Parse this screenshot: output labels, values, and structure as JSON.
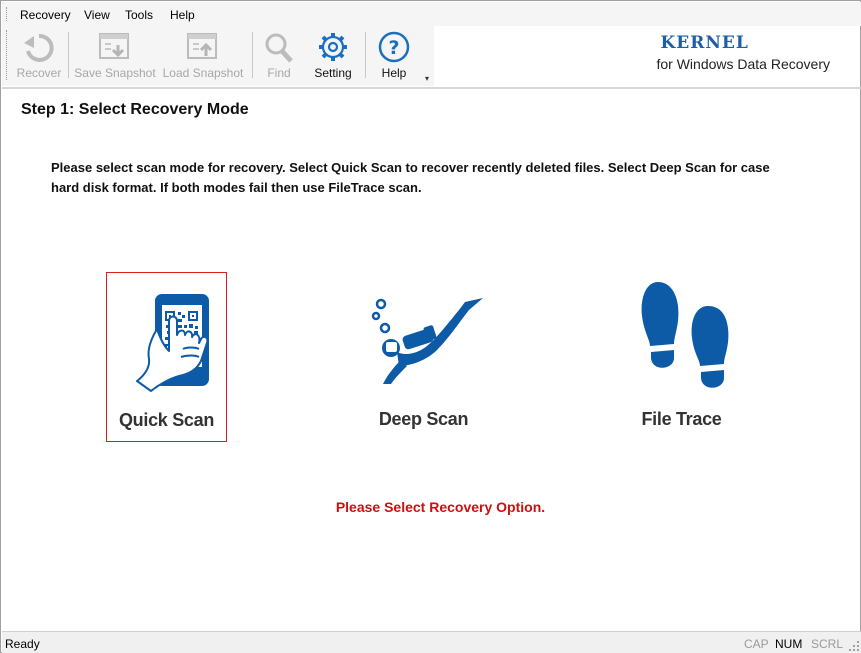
{
  "menu": {
    "items": [
      {
        "label": "Recovery"
      },
      {
        "label": "View"
      },
      {
        "label": "Tools"
      },
      {
        "label": "Help"
      }
    ]
  },
  "toolbar": {
    "buttons": [
      {
        "label": "Recover",
        "icon": "recover-icon",
        "enabled": false
      },
      {
        "label": "Save Snapshot",
        "icon": "save-snapshot-icon",
        "enabled": false
      },
      {
        "label": "Load Snapshot",
        "icon": "load-snapshot-icon",
        "enabled": false
      },
      {
        "label": "Find",
        "icon": "find-icon",
        "enabled": false
      },
      {
        "label": "Setting",
        "icon": "gear-icon",
        "enabled": true
      },
      {
        "label": "Help",
        "icon": "help-icon",
        "enabled": true
      }
    ],
    "overflow_glyph": "▾"
  },
  "brand": {
    "name": "KERNEL",
    "subtitle": "for Windows Data Recovery",
    "color": "#1e5ea8"
  },
  "main": {
    "step_title": "Step 1: Select Recovery Mode",
    "instructions_line1": "Please select scan mode for recovery. Select Quick Scan to recover recently deleted files. Select Deep Scan for case",
    "instructions_line2": "hard disk format. If both modes fail then use FileTrace scan.",
    "modes": [
      {
        "label": "Quick Scan",
        "icon": "qr-phone-icon",
        "selected": true
      },
      {
        "label": "Deep Scan",
        "icon": "diver-icon",
        "selected": false
      },
      {
        "label": "File Trace",
        "icon": "footprints-icon",
        "selected": false
      }
    ],
    "select_message": "Please Select Recovery Option.",
    "accent_color": "#0d5ba6",
    "alert_color": "#cc1010"
  },
  "status": {
    "text": "Ready",
    "indicators": [
      {
        "label": "CAP",
        "active": false
      },
      {
        "label": "NUM",
        "active": true
      },
      {
        "label": "SCRL",
        "active": false
      }
    ]
  }
}
